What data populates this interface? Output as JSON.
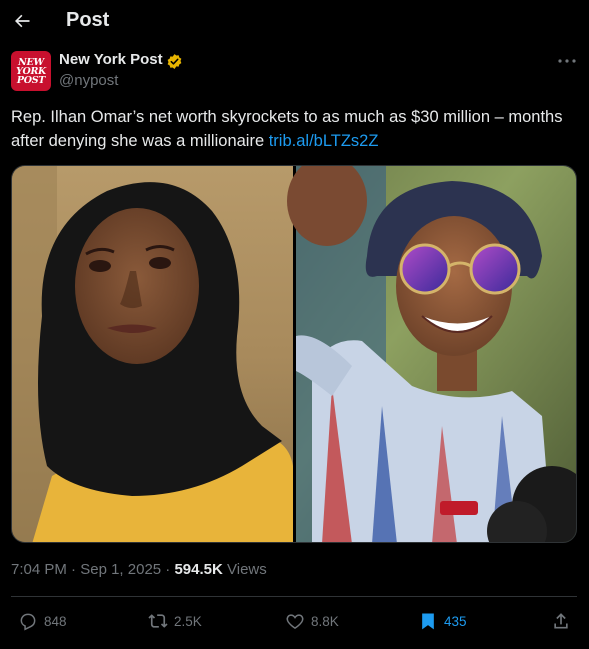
{
  "header": {
    "title": "Post"
  },
  "author": {
    "name": "New York Post",
    "handle": "@nypost",
    "avatar_lines": [
      "NEW",
      "YORK",
      "POST"
    ],
    "verified_color": "#e8b500"
  },
  "tweet": {
    "text": "Rep. Ilhan Omar’s net worth skyrockets to as much as $30 million – months after denying she was a millionaire ",
    "link": "trib.al/bLTZs2Z"
  },
  "meta": {
    "time": "7:04 PM",
    "separator": "·",
    "date": "Sep 1, 2025",
    "views_count": "594.5K",
    "views_label": "Views"
  },
  "actions": {
    "replies": "848",
    "reposts": "2.5K",
    "likes": "8.8K",
    "bookmarks": "435"
  },
  "colors": {
    "accent": "#1d9bf0",
    "background": "#000000",
    "muted": "#71767b",
    "text": "#e7e9ea"
  }
}
